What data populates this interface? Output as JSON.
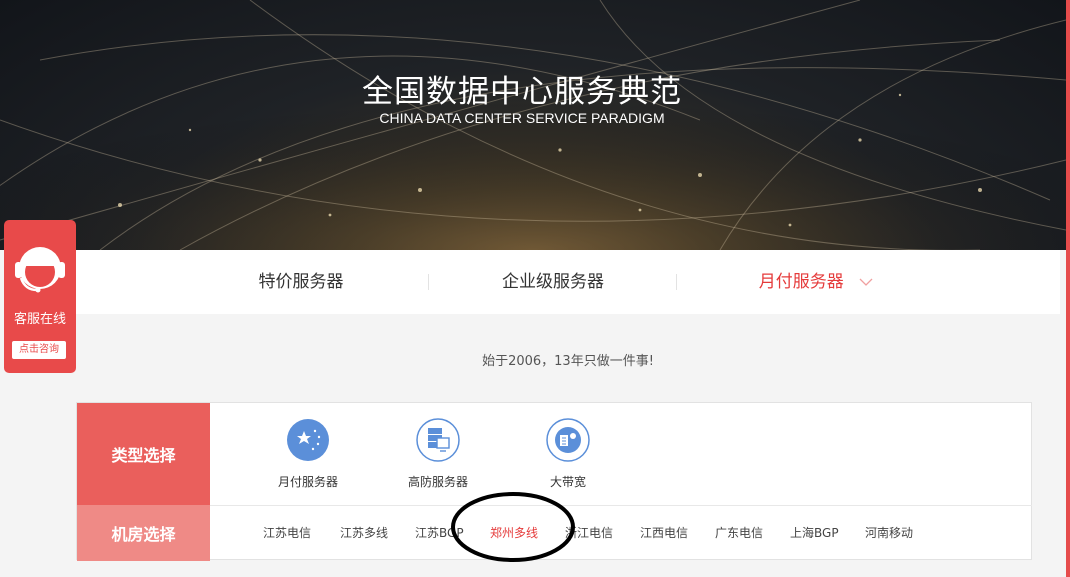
{
  "hero": {
    "title": "全国数据中心服务典范",
    "subtitle": "CHINA DATA CENTER SERVICE PARADIGM"
  },
  "tabs": [
    {
      "label": "特价服务器",
      "active": false
    },
    {
      "label": "企业级服务器",
      "active": false
    },
    {
      "label": "月付服务器",
      "active": true,
      "icon": "chevron-down-icon"
    }
  ],
  "slogan": "始于2006，13年只做一件事!",
  "selector": {
    "type_label": "类型选择",
    "room_label": "机房选择",
    "types": [
      {
        "label": "月付服务器",
        "icon": "star-globe-icon"
      },
      {
        "label": "高防服务器",
        "icon": "server-shield-icon"
      },
      {
        "label": "大带宽",
        "icon": "bandwidth-globe-icon"
      }
    ],
    "rooms": [
      {
        "label": "江苏电信",
        "active": false
      },
      {
        "label": "江苏多线",
        "active": false
      },
      {
        "label": "江苏BGP",
        "active": false
      },
      {
        "label": "郑州多线",
        "active": true
      },
      {
        "label": "浙江电信",
        "active": false
      },
      {
        "label": "江西电信",
        "active": false
      },
      {
        "label": "广东电信",
        "active": false
      },
      {
        "label": "上海BGP",
        "active": false
      },
      {
        "label": "河南移动",
        "active": false
      }
    ]
  },
  "customer_service": {
    "label": "客服在线",
    "button": "点击咨询"
  },
  "colors": {
    "accent": "#e53b3b",
    "type_label_bg": "#ea5f5c",
    "room_label_bg": "#ef8a86",
    "icon_blue": "#5b8fd9"
  }
}
